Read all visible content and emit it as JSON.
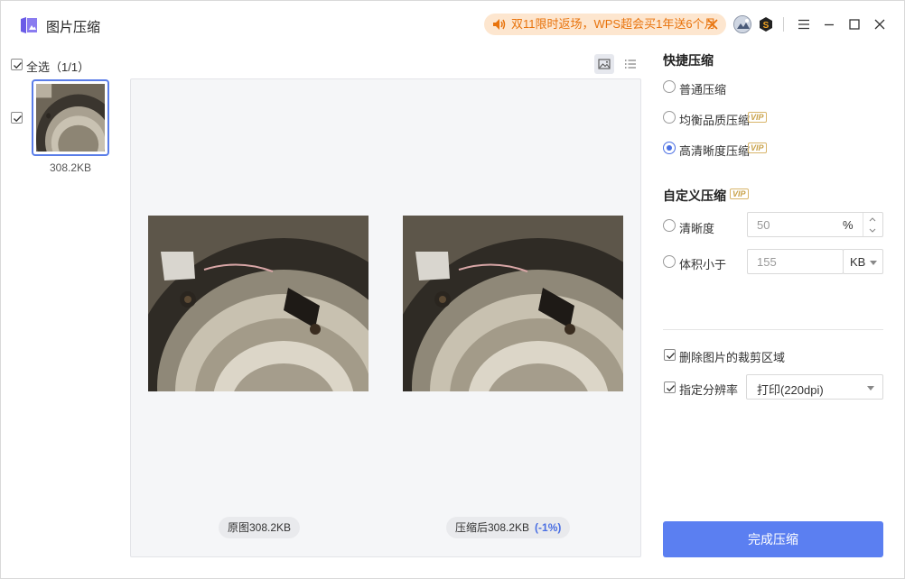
{
  "app": {
    "title": "图片压缩",
    "promo_text": "双11限时返场，WPS超会买1年送6个月",
    "brand_color": "#5b7ff1",
    "promo_color": "#e8730c"
  },
  "left": {
    "select_all_label": "全选（1/1）",
    "files": [
      {
        "size": "308.2KB",
        "checked": true
      }
    ]
  },
  "preview": {
    "original_caption": "原图308.2KB",
    "compressed_caption": "压缩后308.2KB",
    "compressed_delta": "(-1%)"
  },
  "quick": {
    "title": "快捷压缩",
    "options": [
      {
        "label": "普通压缩",
        "vip": false,
        "selected": false
      },
      {
        "label": "均衡品质压缩",
        "vip": true,
        "selected": false
      },
      {
        "label": "高清晰度压缩",
        "vip": true,
        "selected": true
      }
    ],
    "vip_text": "VIP"
  },
  "custom": {
    "title": "自定义压缩",
    "clarity_label": "清晰度",
    "clarity_value": "50",
    "clarity_unit": "%",
    "size_label": "体积小于",
    "size_value": "155",
    "size_unit": "KB"
  },
  "extra": {
    "remove_crop_label": "删除图片的裁剪区域",
    "resolution_label": "指定分辨率",
    "resolution_value": "打印(220dpi)"
  },
  "action": {
    "finish_label": "完成压缩"
  }
}
